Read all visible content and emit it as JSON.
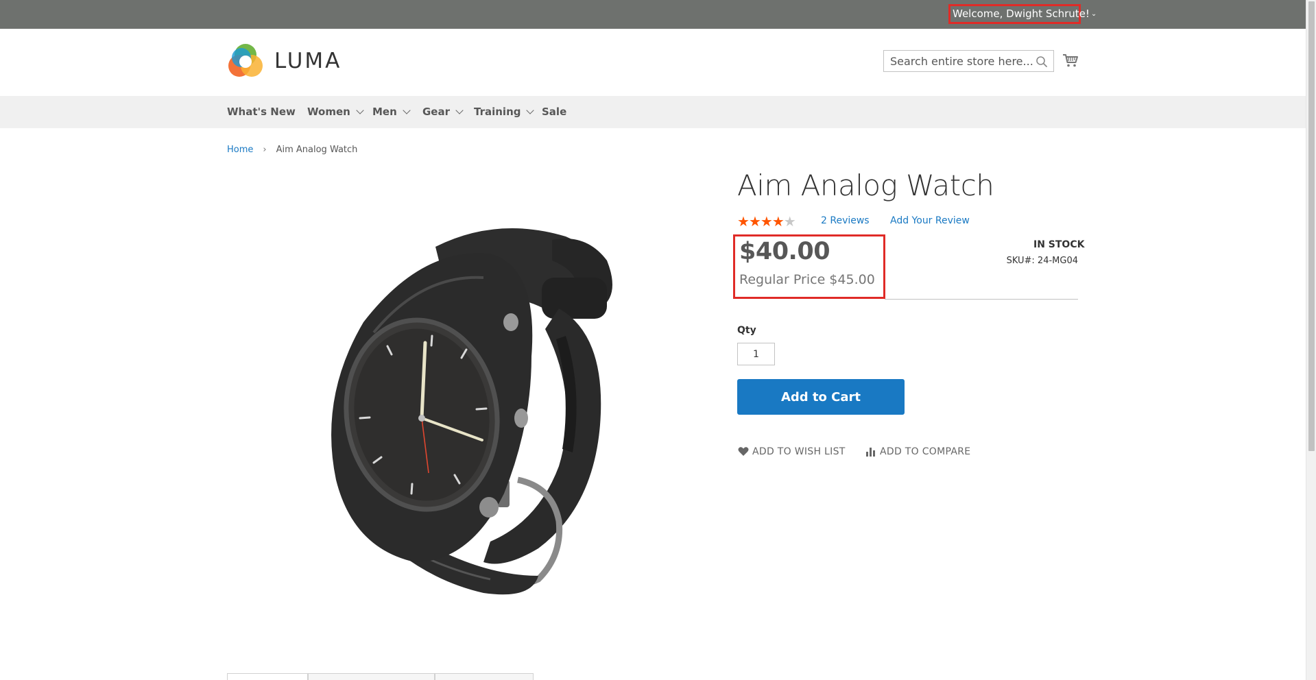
{
  "header": {
    "welcome_text": "Welcome, Dwight Schrute!",
    "logo_text": "LUMA",
    "search_placeholder": "Search entire store here..."
  },
  "nav": {
    "items": [
      {
        "label": "What's New"
      },
      {
        "label": "Women"
      },
      {
        "label": "Men"
      },
      {
        "label": "Gear"
      },
      {
        "label": "Training"
      },
      {
        "label": "Sale"
      }
    ]
  },
  "breadcrumb": {
    "home": "Home",
    "separator": "›",
    "current": "Aim Analog Watch"
  },
  "product": {
    "title": "Aim Analog Watch",
    "rating_stars": 4,
    "rating_max": 5,
    "reviews_link": "2  Reviews",
    "add_review_link": "Add Your Review",
    "final_price": "$40.00",
    "regular_price": "Regular Price $45.00",
    "stock_status": "IN STOCK",
    "sku": "SKU#:  24-MG04",
    "qty_label": "Qty",
    "qty_value": "1",
    "add_to_cart_label": "Add to Cart",
    "wishlist_label": "Add to Wish List",
    "compare_label": "Add to Compare"
  },
  "colors": {
    "accent": "#1979c3",
    "highlight": "#e02b27",
    "stars": "#ff5501",
    "top_bar": "#6e716e"
  },
  "icons": {
    "search": "search-icon",
    "cart": "cart-icon",
    "wishlist": "heart-icon",
    "compare": "bar-chart-icon"
  }
}
